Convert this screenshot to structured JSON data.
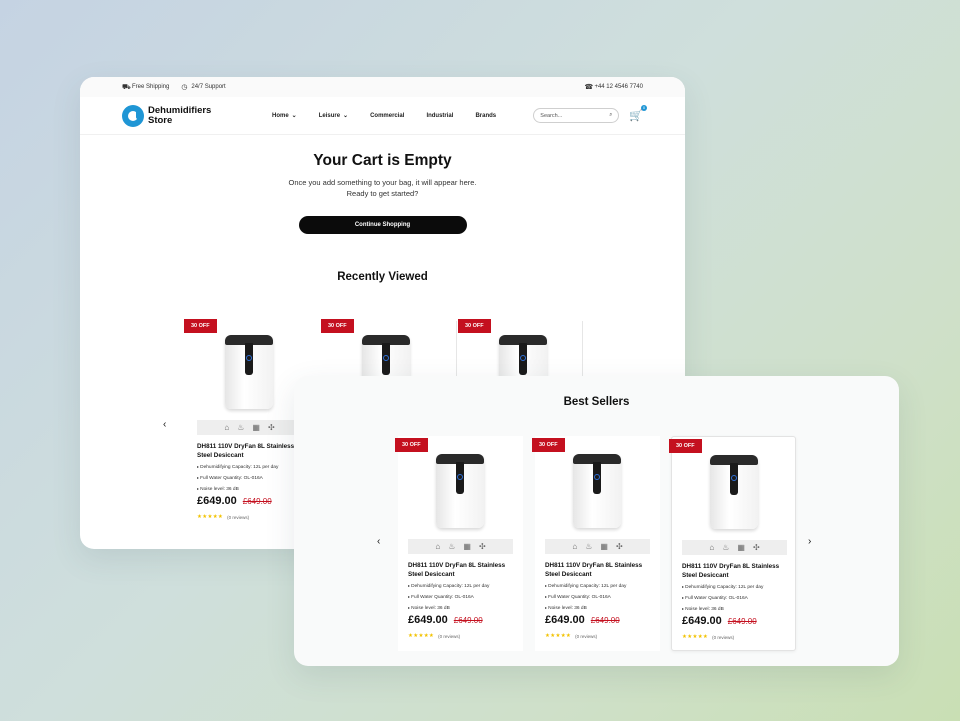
{
  "topbar": {
    "shipping": "Free Shipping",
    "support": "24/7 Support",
    "phone": "+44 12 4546 7740"
  },
  "logo": {
    "line1": "Dehumidifiers",
    "line2": "Store"
  },
  "nav": [
    {
      "label": "Home",
      "has_dropdown": true
    },
    {
      "label": "Leisure",
      "has_dropdown": true
    },
    {
      "label": "Commercial",
      "has_dropdown": false
    },
    {
      "label": "Industrial",
      "has_dropdown": false
    },
    {
      "label": "Brands",
      "has_dropdown": false
    }
  ],
  "search": {
    "placeholder": "Search..."
  },
  "cart": {
    "count": "0"
  },
  "empty_cart": {
    "title": "Your Cart is Empty",
    "line1": "Once you add something to your bag, it will appear here.",
    "line2": "Ready to get started?",
    "button": "Continue Shopping"
  },
  "recently_viewed": {
    "title": "Recently Viewed"
  },
  "best_sellers": {
    "title": "Best Sellers"
  },
  "product": {
    "badge": "30 OFF",
    "title": "DH811 110V DryFan 8L Stainless Steel Desiccant",
    "specs": [
      "Dehumidifying Capacity: 12L per day",
      "Full Water Quantity: OL-016A",
      "Noise level: 36 dB"
    ],
    "price": "£649.00",
    "old_price": "£649.00",
    "stars": "★★★★★",
    "reviews": "(0 reviews)"
  },
  "icons": {
    "features": [
      "home-icon",
      "shower-icon",
      "building-icon",
      "fan-icon"
    ]
  },
  "colors": {
    "badge": "#c4101f",
    "brand": "#1f96d5",
    "button": "#0b0b0b",
    "stars": "#f2c200"
  }
}
